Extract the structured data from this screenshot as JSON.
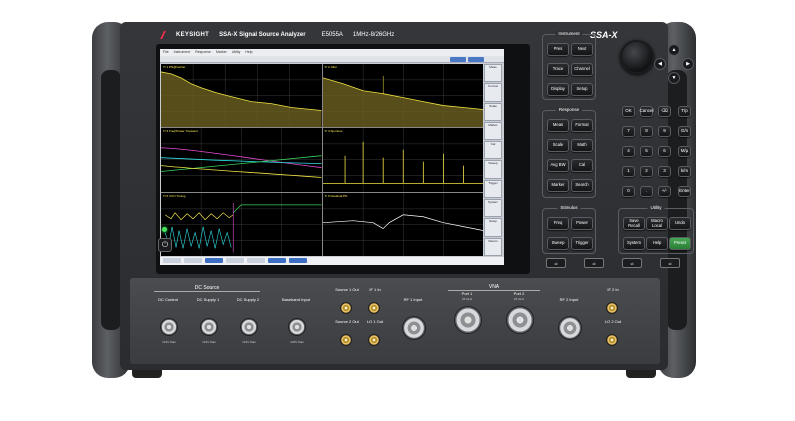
{
  "brand": {
    "name": "KEYSIGHT",
    "product_line": "SSA-X Signal Source Analyzer",
    "model_number": "E5055A",
    "frequency_range": "1MHz-8/26GHz",
    "model_badge": "SSA-X"
  },
  "screen": {
    "menu": [
      "File",
      "Instrument",
      "Response",
      "Marker",
      "Utility",
      "Help"
    ],
    "panels": [
      {
        "header": "Tr 1 PN@Carrier"
      },
      {
        "header": "Tr 2 Jitter"
      },
      {
        "header": "Tr 3 Freq/Power Transient"
      },
      {
        "header": "Tr 4 Spurious"
      },
      {
        "header": "Tr 5 VCO Tuning"
      },
      {
        "header": "Tr 6 Residual PN"
      }
    ],
    "softkeys": [
      "Meas",
      "Format",
      "Scale",
      "Marker",
      "Cal",
      "Sweep",
      "Trigger",
      "System",
      "Setup",
      "Return"
    ]
  },
  "groups": {
    "instrument": {
      "title": "Instrument",
      "keys": [
        "Pres",
        "Next",
        "Trace",
        "Channel",
        "Display",
        "Setup"
      ]
    },
    "response": {
      "title": "Response",
      "keys": [
        "Meas",
        "Format",
        "Scale",
        "Math",
        "Avg BW",
        "Cal",
        "Marker",
        "Search"
      ]
    },
    "stimulus": {
      "title": "Stimulus",
      "keys": [
        "Freq",
        "Power",
        "Sweep",
        "Trigger"
      ]
    },
    "utility": {
      "title": "Utility",
      "keys": [
        "Save Recall",
        "Macro Local",
        "Undo",
        "System",
        "Help",
        "Preset"
      ]
    },
    "numpad": {
      "keys": [
        "OK",
        "Cancel",
        "⌫",
        "T/p",
        "7",
        "8",
        "9",
        "G/n",
        "4",
        "5",
        "6",
        "M/μ",
        "1",
        "2",
        "3",
        "k/m",
        "0",
        ".",
        "+/-",
        "Enter"
      ]
    }
  },
  "arrows": {
    "up": "▲",
    "down": "▼",
    "left": "◀",
    "right": "▶"
  },
  "power_symbol": "⏻",
  "usb_symbol": "⇌",
  "io": {
    "dc_source": {
      "title": "DC Source",
      "ports": [
        {
          "label": "DC Control",
          "spec": "±15V Max"
        },
        {
          "label": "DC Supply 1",
          "spec": "±16V Max"
        },
        {
          "label": "DC Supply 2",
          "spec": "±16V Max"
        }
      ]
    },
    "baseband": {
      "label": "Baseband Input",
      "spec": "±25V Max"
    },
    "source1": {
      "label": "Source 1 Out"
    },
    "source2": {
      "label": "Source 2 Out"
    },
    "if1": {
      "label": "IF 1 In"
    },
    "lo1": {
      "label": "LO 1 Out"
    },
    "rf1": {
      "label": "RF 1 Input"
    },
    "vna": {
      "title": "VNA",
      "port1": {
        "label": "Port 1",
        "spec": "26 GHz"
      },
      "port2": {
        "label": "Port 2",
        "spec": "26 GHz"
      }
    },
    "rf2": {
      "label": "RF 2 Input"
    },
    "if2": {
      "label": "IF 2 In"
    },
    "lo2": {
      "label": "LO 2 Out"
    }
  },
  "colors": {
    "trace_yellow": "#f0e442",
    "trace_cyan": "#2fe0e6",
    "trace_magenta": "#e84bd8",
    "trace_green": "#37d35a",
    "preset_green": "#46a853",
    "brand_red": "#e8304a"
  }
}
